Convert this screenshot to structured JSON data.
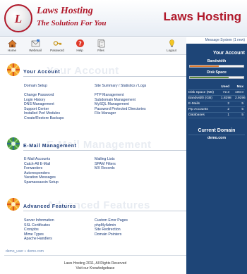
{
  "brand": {
    "logo_text": "L",
    "name": "Laws Hosting",
    "tagline": "The Solution For You",
    "right_title": "Laws Hosting"
  },
  "toolbar": {
    "items": [
      {
        "label": "Home",
        "icon": "home-icon"
      },
      {
        "label": "Webmail",
        "icon": "mail-icon"
      },
      {
        "label": "Password",
        "icon": "key-icon"
      },
      {
        "label": "Help",
        "icon": "help-icon"
      },
      {
        "label": "Files",
        "icon": "files-icon"
      },
      {
        "label": "Logout",
        "icon": "logout-icon"
      }
    ]
  },
  "message_system": "Message System (1 new)",
  "sections": {
    "account": {
      "title": "Your Account",
      "ghost": "Your Account",
      "links_left": [
        "Domain Setup",
        "Change Password",
        "Login History",
        "DNS Management",
        "Support Center",
        "Installed Perl Modules",
        "Create/Restore Backups"
      ],
      "links_right": [
        "Site Summary / Statistics / Logs",
        "FTP Management",
        "Subdomain Management",
        "MySQL Management",
        "Password Protected Directories",
        "File Manager"
      ]
    },
    "email": {
      "title": "E-Mail Management",
      "ghost": "E-Mail Management",
      "links_left": [
        "E-Mail Accounts",
        "Catch-All E-Mail",
        "Forwarders",
        "Autoresponders",
        "Vacation Messages",
        "Spamassassin Setup"
      ],
      "links_right": [
        "Mailing Lists",
        "SPAM Filters",
        "MX Records"
      ]
    },
    "advanced": {
      "title": "Advanced Features",
      "ghost": "Advanced Features",
      "links_left": [
        "Server Information",
        "SSL Certificates",
        "Cronjobs",
        "Mime Types",
        "Apache Handlers"
      ],
      "links_right": [
        "Custom Error Pages",
        "phpMyAdmin",
        "Site Redirection",
        "Domain Pointers"
      ]
    }
  },
  "footer": {
    "user": "demo_user » demo.com",
    "copyright": "Laws Hosting 2011, All Rights Reserved",
    "knowledgebase": "Visit our Knowledgebase"
  },
  "sidebar": {
    "title": "Your Account",
    "bandwidth_label": "Bandwidth",
    "bandwidth_fraction": 0.54,
    "disk_label": "Disk Space",
    "disk_fraction": 0.72,
    "columns": {
      "used": "Used",
      "max": "Max"
    },
    "stats": [
      {
        "name": "Disk Space (MB)",
        "used": "72.3",
        "max": "100.0"
      },
      {
        "name": "Bandwidth (GB)",
        "used": "1.8298",
        "max": "2.9296"
      },
      {
        "name": "E-Mails",
        "used": "2",
        "max": "5"
      },
      {
        "name": "Ftp Accounts",
        "used": "2",
        "max": "5"
      },
      {
        "name": "Databases",
        "used": "1",
        "max": "5"
      }
    ],
    "domain_title": "Current Domain",
    "domain": "demo.com"
  },
  "colors": {
    "brand_red": "#b0182a",
    "sidebar_bg": "#1e4577",
    "bandwidth_fill": "#e07a2e",
    "disk_fill": "#5c8a3a"
  }
}
